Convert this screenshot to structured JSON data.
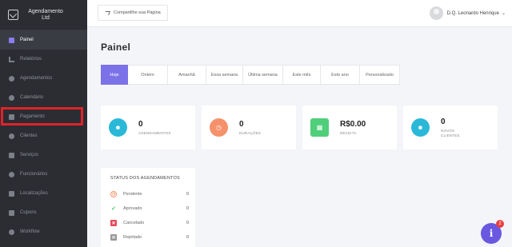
{
  "brand": {
    "name": "Agendamento Ltd"
  },
  "sidebar": {
    "items": [
      {
        "label": "Painel",
        "icon": "dashboard-icon"
      },
      {
        "label": "Relatórios",
        "icon": "chart-icon"
      },
      {
        "label": "Agendamentos",
        "icon": "clock-icon"
      },
      {
        "label": "Calendário",
        "icon": "calendar-icon"
      },
      {
        "label": "Pagamento",
        "icon": "payment-icon"
      },
      {
        "label": "Clientes",
        "icon": "users-icon"
      },
      {
        "label": "Serviços",
        "icon": "services-icon"
      },
      {
        "label": "Funcionários",
        "icon": "employee-icon"
      },
      {
        "label": "Localizações",
        "icon": "location-icon"
      },
      {
        "label": "Cupons",
        "icon": "coupon-icon"
      },
      {
        "label": "Workflow",
        "icon": "workflow-icon"
      }
    ]
  },
  "topbar": {
    "share_label": "Compartilhe sua Página",
    "user_name": "D.Q. Leonardo Henrique"
  },
  "main": {
    "title": "Painel",
    "tabs": [
      "Hoje",
      "Ontem",
      "Amanhã",
      "Essa semana",
      "Última semana",
      "Este mês",
      "Este ano",
      "Personalizado"
    ]
  },
  "cards": [
    {
      "value": "0",
      "label": "AGENDAMENTOS",
      "color": "#29b8d8",
      "icon": "user-icon"
    },
    {
      "value": "0",
      "label": "DURAÇÕES",
      "color": "#f5916b",
      "icon": "clock-icon"
    },
    {
      "value": "R$0.00",
      "label": "RECEITA",
      "color": "#4fcf7a",
      "icon": "money-icon"
    },
    {
      "value": "0",
      "label": "NOVOS CLIENTES",
      "color": "#29b8d8",
      "icon": "user-icon"
    }
  ],
  "status": {
    "title": "STATUS DOS AGENDAMENTOS",
    "rows": [
      {
        "label": "Pendente",
        "count": "0",
        "color": "#f5916b",
        "icon": "clock-icon"
      },
      {
        "label": "Aprovado",
        "count": "0",
        "color": "#3fc46a",
        "icon": "check-icon"
      },
      {
        "label": "Cancelado",
        "count": "0",
        "color": "#e64a5a",
        "icon": "x-icon"
      },
      {
        "label": "Rejeitado",
        "count": "0",
        "color": "#999999",
        "icon": "x-icon"
      }
    ]
  },
  "chat": {
    "badge": "2",
    "icon_char": "i"
  }
}
